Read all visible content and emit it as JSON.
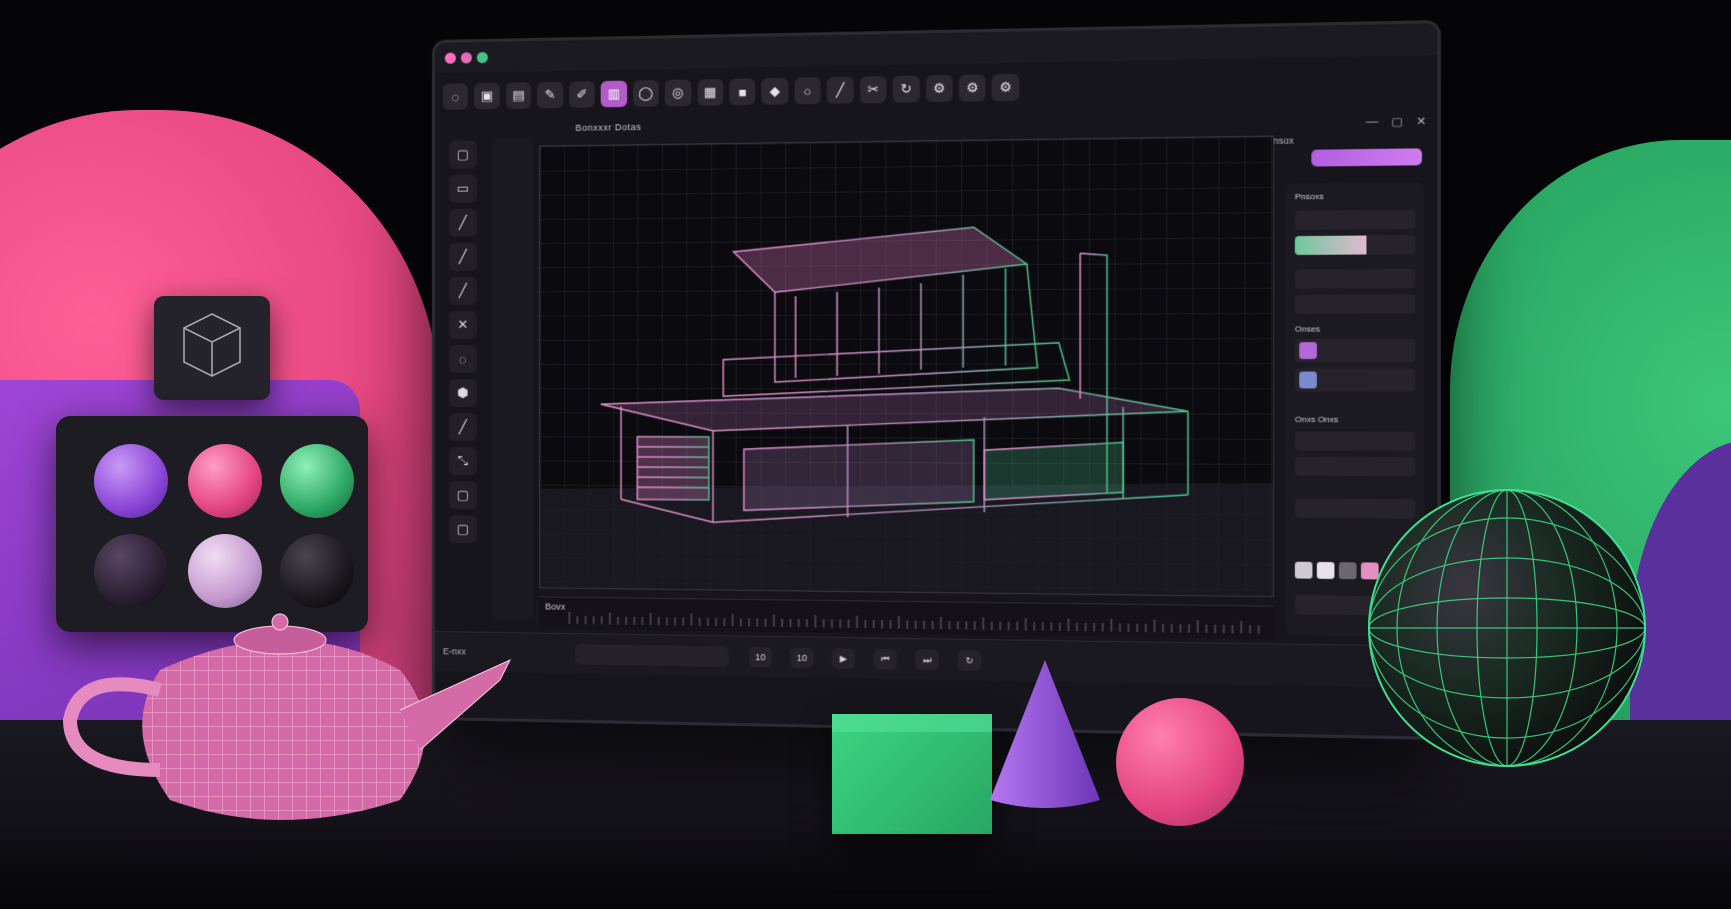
{
  "colors": {
    "accent_purple": "#b25bc9",
    "accent_pink": "#e4457f",
    "accent_green": "#2ea865",
    "panel_bg": "#17151c"
  },
  "app": {
    "viewport_title": "Bonxxxr Dotas",
    "timeline_label": "Bovx",
    "right_panel_header": "Pnsoxs",
    "right_panel_section": "Onses",
    "right_panel_subsection": "Onxs Onxs",
    "bottom_left_label": "E-nxx",
    "bottom_time_a": "10",
    "bottom_time_b": "10",
    "header_right_label": "Pnsox"
  },
  "toolbar_icons": [
    "select-icon",
    "frame-icon",
    "image-icon",
    "brush-icon",
    "pen-icon",
    "picture-icon",
    "circle-icon",
    "circle-icon-2",
    "picture-icon-2",
    "square-icon",
    "diamond-icon",
    "ring-icon",
    "brush-icon-2",
    "paint-icon",
    "refresh-icon",
    "gear-icon",
    "gear-icon-2",
    "gear-icon-3"
  ],
  "toolbar_glyphs": [
    "◌",
    "▣",
    "▤",
    "✎",
    "✐",
    "▥",
    "◯",
    "◎",
    "▦",
    "■",
    "◆",
    "○",
    "╱",
    "✂",
    "↻",
    "⚙",
    "⚙",
    "⚙"
  ],
  "left_tools": [
    "▢",
    "▭",
    "╱",
    "╱",
    "╱",
    "✕",
    "◌",
    "⬢",
    "╱",
    "⤡",
    "▢",
    "▢"
  ],
  "swatches": [
    "#cfcad3",
    "#e8e3ea",
    "#6b6670",
    "#e58fc0"
  ]
}
